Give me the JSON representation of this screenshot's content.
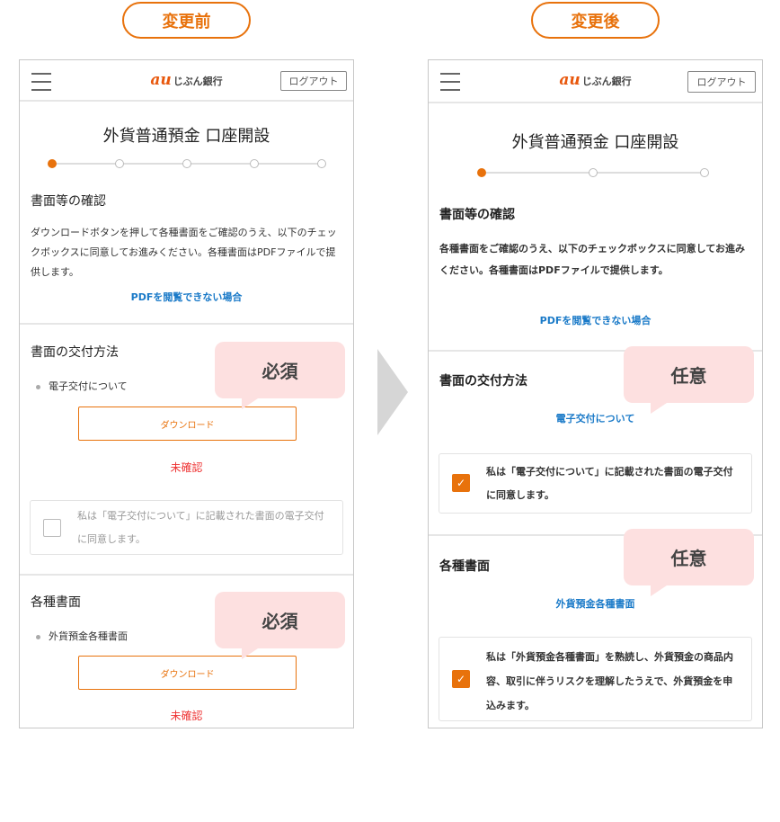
{
  "labels": {
    "before": "変更前",
    "after": "変更後"
  },
  "colors": {
    "accent": "#e8720c",
    "link": "#1a7ac8",
    "error": "#e33333",
    "bubble": "#fde0e0"
  },
  "icons": {
    "menu": "hamburger-icon",
    "check": "checkmark-icon",
    "arrow": "chevron-right-icon"
  },
  "before": {
    "logo_mark": "au",
    "logo_text": "じぶん銀行",
    "logout": "ログアウト",
    "title": "外貨普通預金 口座開設",
    "steps_total": 5,
    "step_current": 1,
    "confirm_heading": "書面等の確認",
    "confirm_text": "ダウンロードボタンを押して各種書面をご確認のうえ、以下のチェックボックスに同意してお進みください。各種書面はPDFファイルで提供します。",
    "pdf_link": "PDFを閲覧できない場合",
    "delivery": {
      "heading": "書面の交付方法",
      "bullet": "電子交付について",
      "download": "ダウンロード",
      "status": "未確認",
      "checkbox": "私は「電子交付について」に記載された書面の電子交付に同意します。",
      "checked": false,
      "badge": "必須"
    },
    "docs": {
      "heading": "各種書面",
      "bullet": "外貨預金各種書面",
      "download": "ダウンロード",
      "status": "未確認",
      "badge": "必須"
    }
  },
  "after": {
    "logo_mark": "au",
    "logo_text": "じぶん銀行",
    "logout": "ログアウト",
    "title": "外貨普通預金 口座開設",
    "steps_total": 3,
    "step_current": 1,
    "confirm_heading": "書面等の確認",
    "confirm_text": "各種書面をご確認のうえ、以下のチェックボックスに同意してお進みください。各種書面はPDFファイルで提供します。",
    "pdf_link": "PDFを閲覧できない場合",
    "delivery": {
      "heading": "書面の交付方法",
      "link": "電子交付について",
      "checkbox": "私は「電子交付について」に記載された書面の電子交付に同意します。",
      "checked": true,
      "badge": "任意"
    },
    "docs": {
      "heading": "各種書面",
      "link": "外貨預金各種書面",
      "checkbox": "私は「外貨預金各種書面」を熟読し、外貨預金の商品内容、取引に伴うリスクを理解したうえで、外貨預金を申込みます。",
      "checked": true,
      "badge": "任意"
    }
  }
}
